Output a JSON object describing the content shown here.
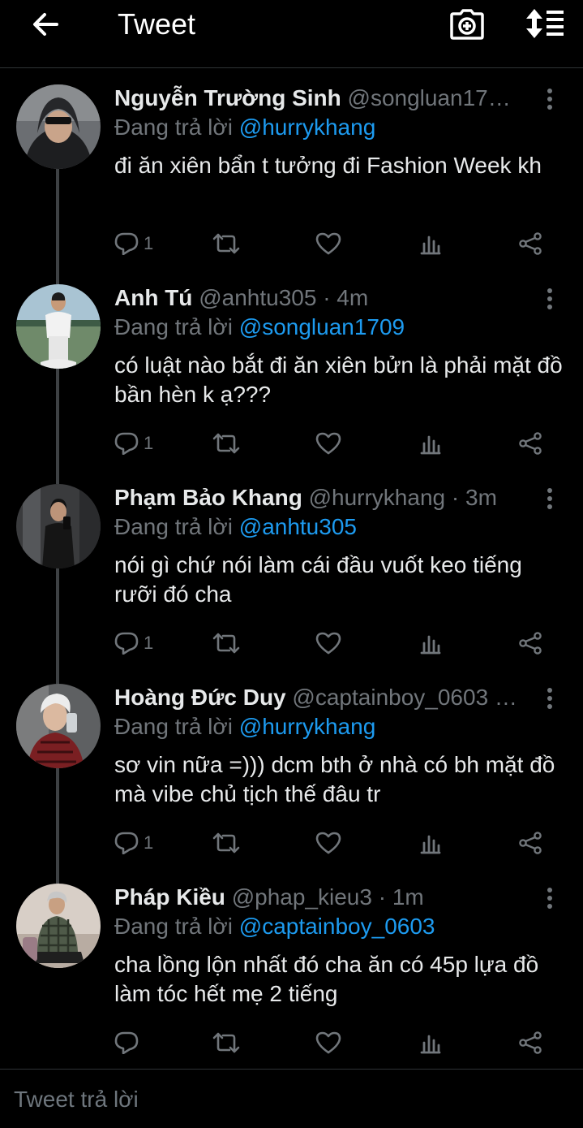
{
  "header": {
    "title": "Tweet",
    "back_icon": "arrow-left-icon",
    "camera_icon": "camera-plus-icon",
    "sort_icon": "sort-icon"
  },
  "reply_prefix": "Đang trả lời",
  "tweets": [
    {
      "name": "Nguyễn Trường Sinh",
      "handle": "@songluan17…",
      "time": "",
      "reply_to": "@hurrykhang",
      "text": "đi ăn xiên bẩn t tưởng đi Fashion Week kh",
      "replies": "1",
      "retweets": "",
      "likes": ""
    },
    {
      "name": "Anh Tú",
      "handle": "@anhtu305",
      "time": "· 4m",
      "reply_to": "@songluan1709",
      "text": "có luật nào bắt đi ăn xiên bửn là phải mặt đồ bần hèn k ạ???",
      "replies": "1",
      "retweets": "",
      "likes": ""
    },
    {
      "name": "Phạm Bảo Khang",
      "handle": "@hurrykhang",
      "time": "· 3m",
      "reply_to": "@anhtu305",
      "text": "nói gì chứ nói làm cái đầu vuốt keo tiếng rưỡi đó cha",
      "replies": "1",
      "retweets": "",
      "likes": ""
    },
    {
      "name": "Hoàng Đức Duy",
      "handle": "@captainboy_0603 …",
      "time": "",
      "reply_to": "@hurrykhang",
      "text": "sơ vin nữa =))) dcm bth ở nhà có bh mặt đồ mà vibe chủ tịch thế đâu tr",
      "replies": "1",
      "retweets": "",
      "likes": ""
    },
    {
      "name": "Pháp Kiều",
      "handle": "@phap_kieu3",
      "time": "· 1m",
      "reply_to": "@captainboy_0603",
      "text": "cha lồng lộn nhất đó cha ăn có 45p lựa đồ làm tóc hết mẹ 2 tiếng",
      "replies": "",
      "retweets": "",
      "likes": ""
    }
  ],
  "footer": {
    "placeholder": "Tweet trả lời"
  },
  "colors": {
    "background": "#000000",
    "text": "#e7e9ea",
    "muted": "#71767b",
    "link": "#1d9bf0",
    "divider": "#2f3336"
  }
}
